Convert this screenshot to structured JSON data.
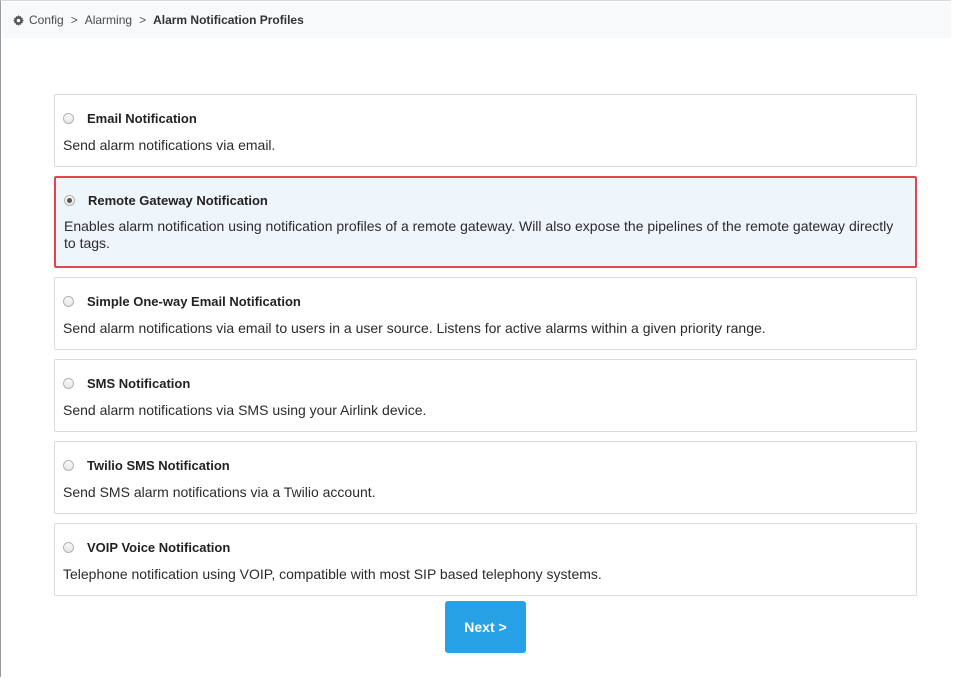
{
  "breadcrumb": {
    "items": [
      "Config",
      "Alarming"
    ],
    "separator": ">",
    "current": "Alarm Notification Profiles"
  },
  "options": [
    {
      "title": "Email Notification",
      "description": "Send alarm notifications via email.",
      "selected": false
    },
    {
      "title": "Remote Gateway Notification",
      "description": "Enables alarm notification using notification profiles of a remote gateway. Will also expose the pipelines of the remote gateway directly to tags.",
      "selected": true
    },
    {
      "title": "Simple One-way Email Notification",
      "description": "Send alarm notifications via email to users in a user source. Listens for active alarms within a given priority range.",
      "selected": false
    },
    {
      "title": "SMS Notification",
      "description": "Send alarm notifications via SMS using your Airlink device.",
      "selected": false
    },
    {
      "title": "Twilio SMS Notification",
      "description": "Send SMS alarm notifications via a Twilio account.",
      "selected": false
    },
    {
      "title": "VOIP Voice Notification",
      "description": "Telephone notification using VOIP, compatible with most SIP based telephony systems.",
      "selected": false
    }
  ],
  "actions": {
    "next_label": "Next >"
  },
  "colors": {
    "accent": "#27a1e6",
    "selection_border": "#e0464f",
    "selection_background": "#eef5fb"
  }
}
